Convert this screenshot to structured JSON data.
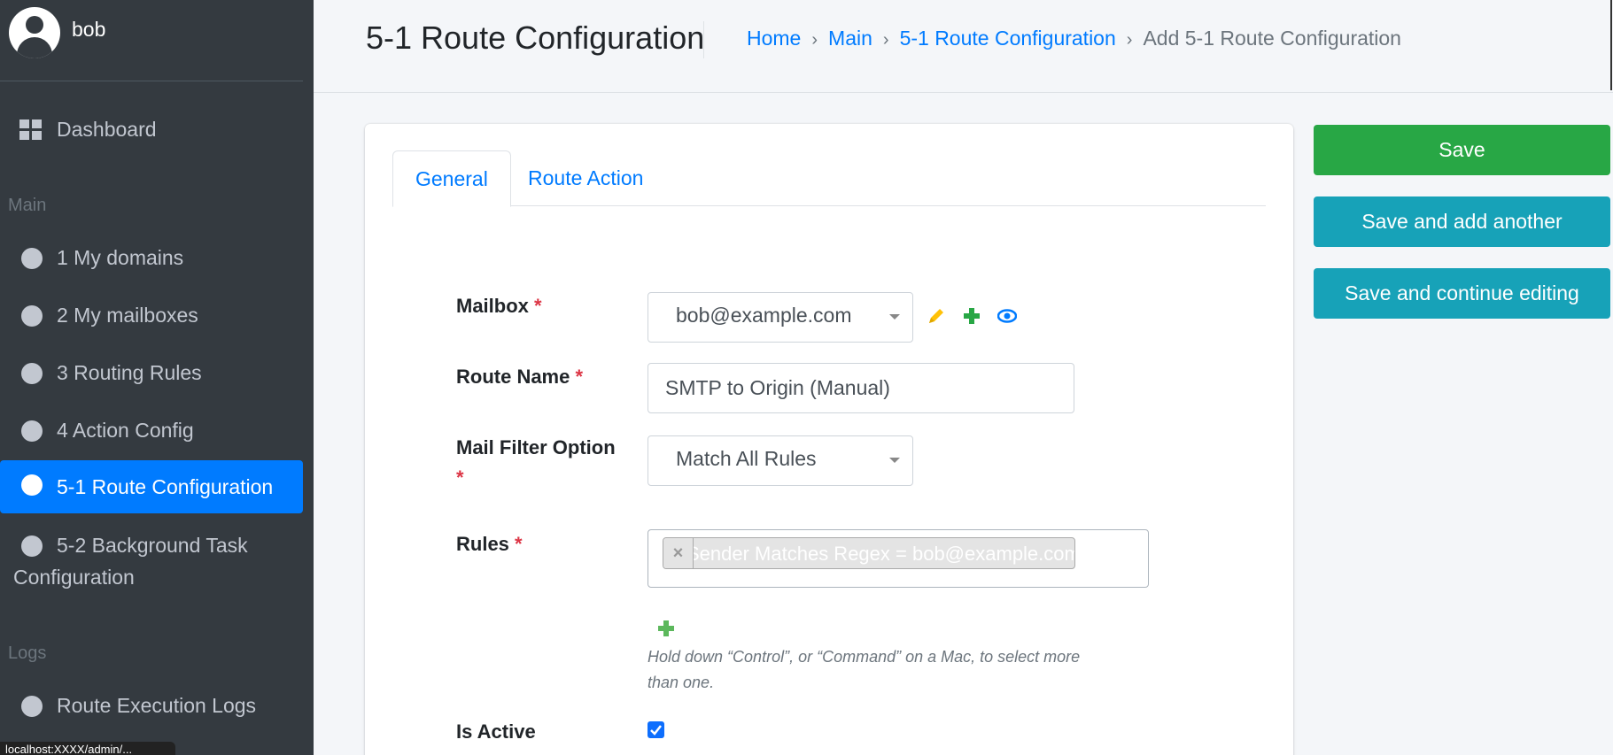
{
  "user": {
    "name": "bob"
  },
  "sidebar": {
    "dashboard": "Dashboard",
    "section_main": "Main",
    "items": [
      {
        "label": "1 My domains"
      },
      {
        "label": "2 My mailboxes"
      },
      {
        "label": "3 Routing Rules"
      },
      {
        "label": "4 Action Config"
      },
      {
        "label": "5-1 Route Configuration",
        "active": true
      },
      {
        "label_line1": "5-2 Background Task",
        "label_line2": "Configuration"
      }
    ],
    "section_logs": "Logs",
    "logs_item": "Route Execution Logs",
    "status_url": "localhost:XXXX/admin/..."
  },
  "header": {
    "title": "5-1 Route Configuration",
    "breadcrumb": [
      "Home",
      "Main",
      "5-1 Route Configuration",
      "Add 5-1 Route Configuration"
    ],
    "breadcrumb_sep": "›"
  },
  "tabs": [
    "General",
    "Route Action"
  ],
  "form": {
    "mailbox": {
      "label": "Mailbox",
      "value": "bob@example.com"
    },
    "route_name": {
      "label": "Route Name",
      "value": "SMTP to Origin (Manual)"
    },
    "mail_filter": {
      "label": "Mail Filter Option",
      "value": "Match All Rules"
    },
    "rules": {
      "label": "Rules",
      "chip": "Sender Matches Regex = bob@example.com",
      "remove": "×"
    },
    "help_text": "Hold down “Control”, or “Command” on a Mac, to select more than one.",
    "is_active": {
      "label": "Is Active",
      "checked": true
    },
    "required_mark": "*"
  },
  "buttons": {
    "save": "Save",
    "save_add": "Save and add another",
    "save_continue": "Save and continue editing"
  },
  "colors": {
    "sidebar_bg": "#343a40",
    "active": "#007bff",
    "save": "#28a745",
    "info": "#17a2b8",
    "edit_icon": "#ffc107",
    "add_icon": "#28a745",
    "view_icon": "#007bff"
  }
}
